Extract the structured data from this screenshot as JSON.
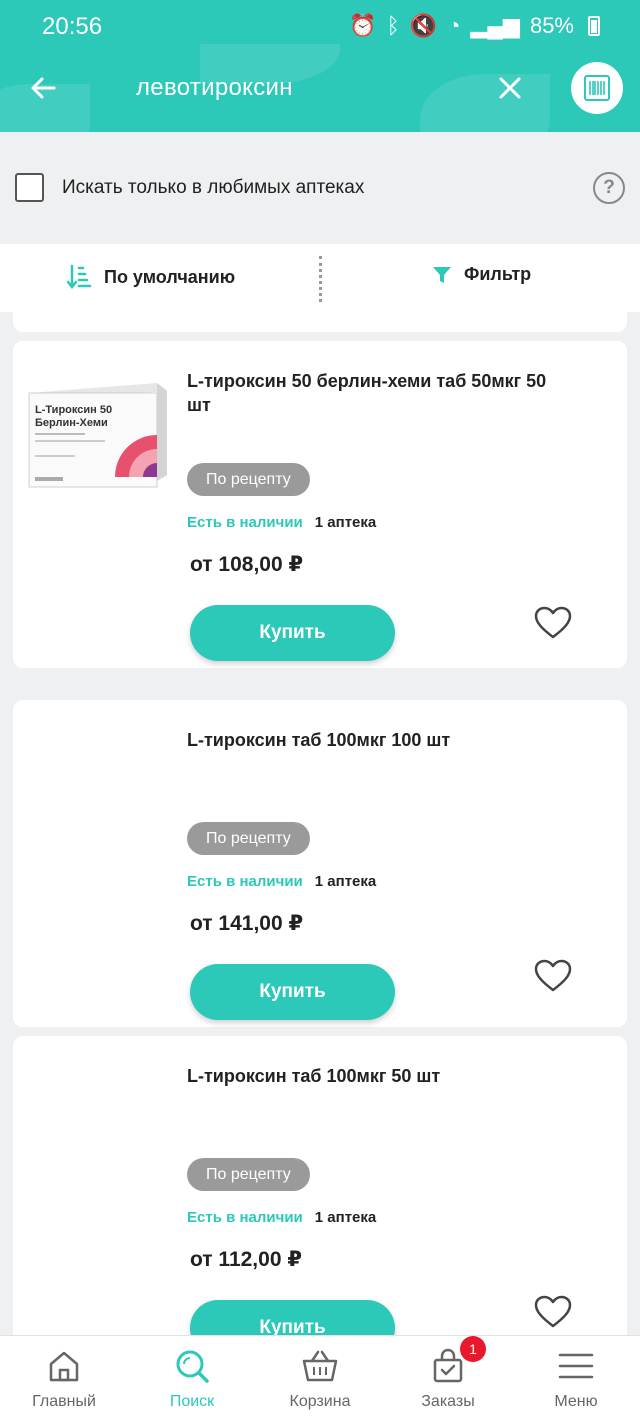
{
  "status_bar": {
    "time": "20:56",
    "battery": "85%"
  },
  "search": {
    "query": "левотироксин"
  },
  "favorites_filter": {
    "label": "Искать только в любимых аптеках",
    "checked": false
  },
  "sort_bar": {
    "sort_label": "По умолчанию",
    "filter_label": "Фильтр"
  },
  "products": [
    {
      "title": "L-тироксин 50 берлин-хеми таб 50мкг 50 шт",
      "package_brand": "L-Тироксин 50",
      "package_maker": "Берлин-Хеми",
      "rx_label": "По рецепту",
      "stock_label": "Есть в наличии",
      "stock_count": "1 аптека",
      "price": "от 108,00 ₽",
      "buy_label": "Купить",
      "has_image": true
    },
    {
      "title": "L-тироксин таб 100мкг 100 шт",
      "rx_label": "По рецепту",
      "stock_label": "Есть в наличии",
      "stock_count": "1 аптека",
      "price": "от 141,00 ₽",
      "buy_label": "Купить",
      "has_image": false
    },
    {
      "title": "L-тироксин таб 100мкг 50 шт",
      "rx_label": "По рецепту",
      "stock_label": "Есть в наличии",
      "stock_count": "1 аптека",
      "price": "от 112,00 ₽",
      "buy_label": "Купить",
      "has_image": false
    }
  ],
  "bottom_nav": {
    "items": [
      {
        "label": "Главный",
        "icon": "home-icon"
      },
      {
        "label": "Поиск",
        "icon": "search-icon",
        "active": true
      },
      {
        "label": "Корзина",
        "icon": "basket-icon"
      },
      {
        "label": "Заказы",
        "icon": "orders-icon",
        "badge": "1"
      },
      {
        "label": "Меню",
        "icon": "menu-icon"
      }
    ]
  },
  "colors": {
    "accent": "#2cc8b8",
    "badge": "#e8192c",
    "rx_badge": "#9a9a9a"
  }
}
